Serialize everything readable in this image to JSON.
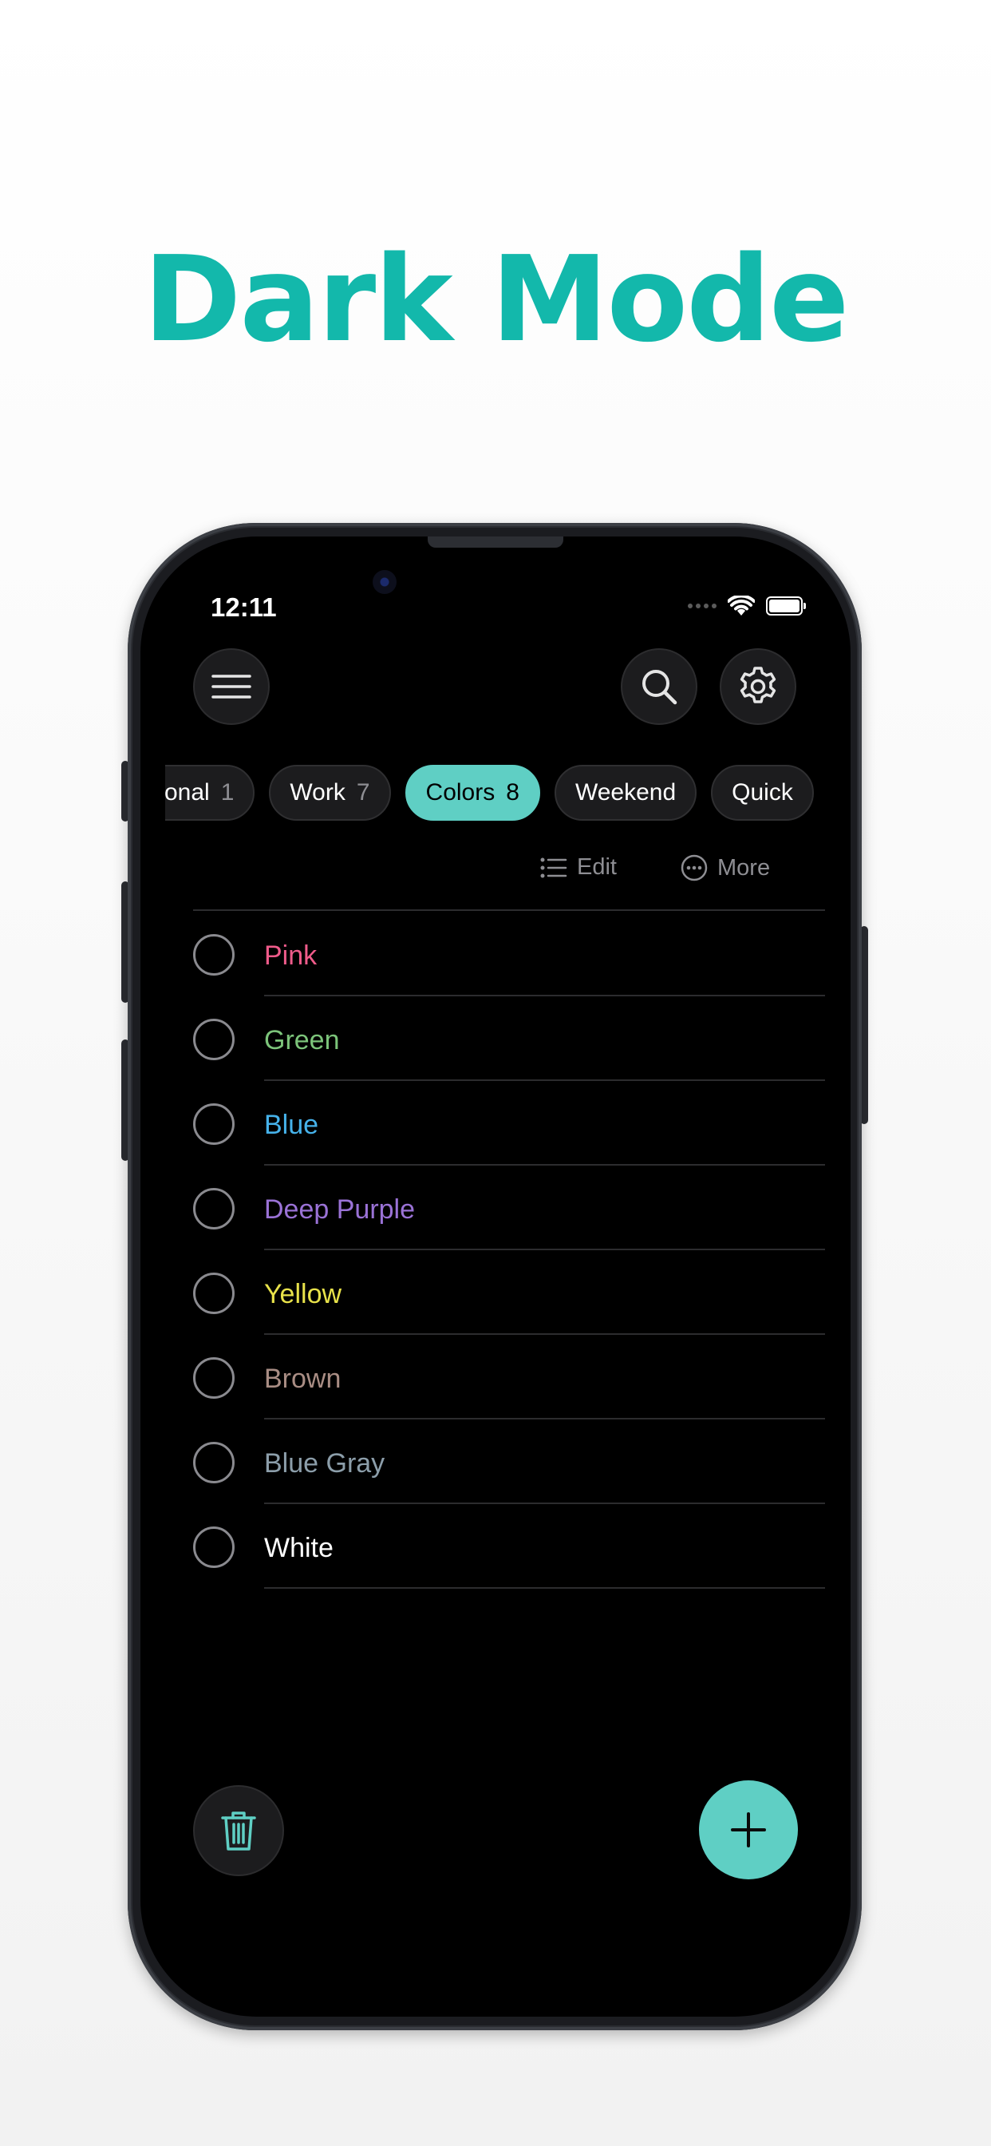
{
  "headline": "Dark Mode",
  "status": {
    "time": "12:11"
  },
  "icons": {
    "menu": "hamburger-menu-icon",
    "search": "search-icon",
    "settings": "gear-icon",
    "edit": "list-icon",
    "more": "ellipsis-circle-icon",
    "trash": "trash-icon",
    "add": "plus-icon"
  },
  "chips": [
    {
      "label": "rsonal",
      "count": "1"
    },
    {
      "label": "Work",
      "count": "7"
    },
    {
      "label": "Colors",
      "count": "8",
      "active": true
    },
    {
      "label": "Weekend",
      "count": ""
    },
    {
      "label": "Quick",
      "count": ""
    }
  ],
  "toolbar": {
    "edit_label": "Edit",
    "more_label": "More"
  },
  "items": [
    {
      "label": "Pink",
      "color": "#ef5b8a"
    },
    {
      "label": "Green",
      "color": "#7cc47a"
    },
    {
      "label": "Blue",
      "color": "#46b2ea"
    },
    {
      "label": "Deep Purple",
      "color": "#9a72d6"
    },
    {
      "label": "Yellow",
      "color": "#e8e24a"
    },
    {
      "label": "Brown",
      "color": "#a98d84"
    },
    {
      "label": "Blue Gray",
      "color": "#8c9eaa"
    },
    {
      "label": "White",
      "color": "#ffffff"
    }
  ],
  "colors": {
    "accent": "#5fcfc4",
    "headline": "#13b8ab",
    "background": "#000000"
  }
}
